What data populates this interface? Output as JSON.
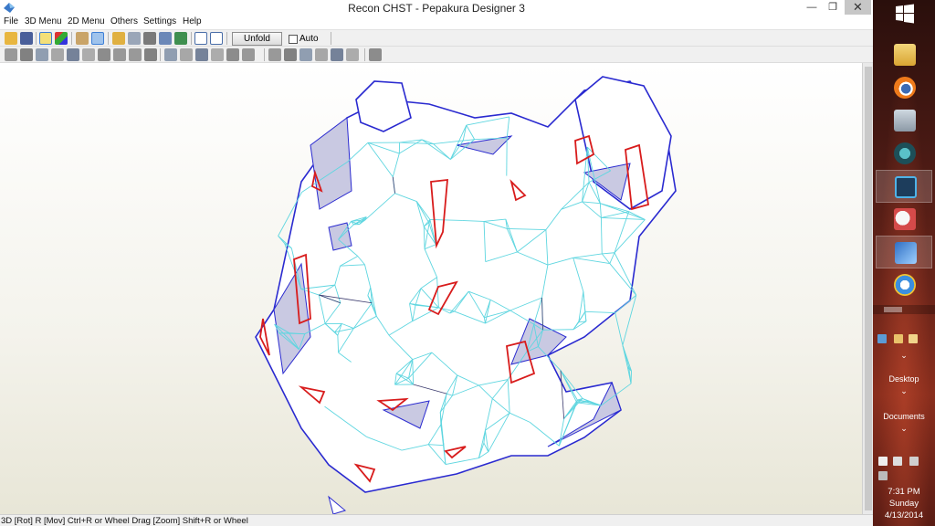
{
  "window": {
    "title": "Recon CHST - Pepakura Designer 3",
    "minimize_glyph": "—",
    "maximize_glyph": "❐",
    "close_glyph": "✕",
    "app_icon": "pepakura-icon"
  },
  "menu": {
    "items": [
      "File",
      "3D Menu",
      "2D Menu",
      "Others",
      "Settings",
      "Help"
    ]
  },
  "toolbar1": {
    "icons": [
      "open-icon",
      "save-icon",
      "light-bulb-icon",
      "texture-cube-icon",
      "flat-cube-icon",
      "box-select-icon",
      "pencil-icon",
      "cylinder-icon",
      "anchor-icon",
      "edge-cut-icon",
      "part-color-icon",
      "frame-left-icon",
      "frame-right-icon"
    ],
    "unfold_label": "Unfold",
    "auto_label": "Auto",
    "auto_checked": false
  },
  "toolbar2": {
    "icons": [
      "select-icon",
      "pointer-icon",
      "grid-icon",
      "wave-icon",
      "tab-icon",
      "strip-icon",
      "join-icon",
      "flap-icon",
      "rotate-icon",
      "back-icon",
      "crop-icon",
      "distribute-icon",
      "text-icon",
      "page-icon",
      "export-icon",
      "align-left-icon",
      "align-center-icon",
      "align-top-icon",
      "align-middle-icon",
      "align-grid-icon",
      "align-bottom-icon",
      "zoom-fit-icon",
      "zoom-reset-icon"
    ]
  },
  "status": {
    "text": "3D [Rot] R [Mov] Ctrl+R or Wheel Drag [Zoom] Shift+R or Wheel"
  },
  "colors": {
    "fold_lines": "#5fd6e0",
    "edges": "#2a2ad0",
    "cut_lines": "#d81c1c",
    "mesh_fill": "#ffffff",
    "shadow_fill": "#c9c9e2"
  },
  "taskbar": {
    "apps": [
      {
        "icon": "windows-start-icon",
        "active": false
      },
      {
        "icon": "file-explorer-icon",
        "active": false
      },
      {
        "icon": "blender-icon",
        "active": false
      },
      {
        "icon": "system-monitor-icon",
        "active": false
      },
      {
        "icon": "audio-app-icon",
        "active": false
      },
      {
        "icon": "robot-app-icon",
        "active": true
      },
      {
        "icon": "pepakura-icon",
        "active": false
      },
      {
        "icon": "pepakura-designer-icon",
        "active": true
      },
      {
        "icon": "internet-explorer-icon",
        "active": false
      }
    ],
    "desktop_label": "Desktop",
    "documents_label": "Documents",
    "chevron": "⌄",
    "time": "7:31 PM",
    "day": "Sunday",
    "date": "4/13/2014"
  }
}
